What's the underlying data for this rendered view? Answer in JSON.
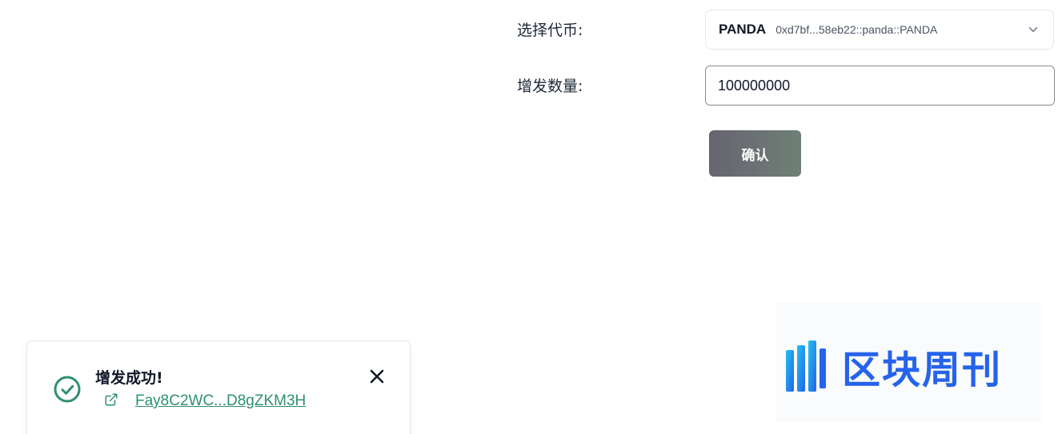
{
  "form": {
    "token_label": "选择代币:",
    "token_symbol": "PANDA",
    "token_address": "0xd7bf...58eb22::panda::PANDA",
    "amount_label": "增发数量:",
    "amount_value": "100000000",
    "confirm_label": "确认"
  },
  "toast": {
    "title": "增发成功!",
    "tx_link": "Fay8C2WC...D8gZKM3H",
    "status_icon": "check-circle-icon",
    "link_icon": "external-link-icon",
    "close_icon": "close-icon"
  },
  "watermark": {
    "text": "区块周刊"
  },
  "colors": {
    "success": "#2f8f73",
    "button_gradient_start": "#676470",
    "button_gradient_end": "#6f7f76",
    "watermark_blue": "#2563eb"
  }
}
